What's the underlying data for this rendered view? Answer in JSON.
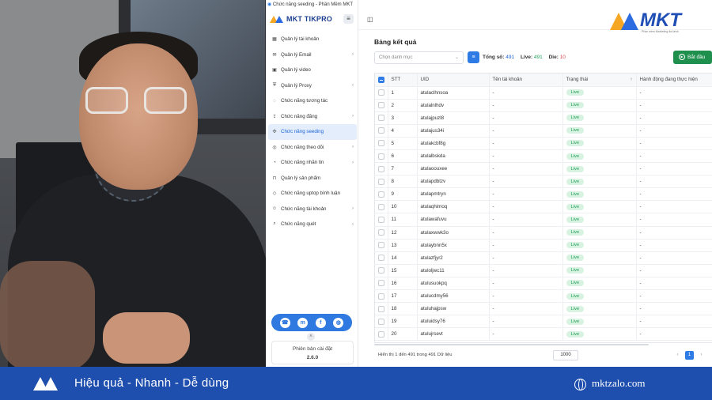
{
  "window": {
    "title": "Chức năng seeding - Phần Mềm MKT"
  },
  "sidebar": {
    "brand": "MKT TIKPRO",
    "items": [
      {
        "label": "Quản lý tài khoản",
        "icon": "grid-icon",
        "chevron": false,
        "active": false
      },
      {
        "label": "Quản lý Email",
        "icon": "mail-icon",
        "chevron": true,
        "active": false
      },
      {
        "label": "Quản lý video",
        "icon": "video-icon",
        "chevron": false,
        "active": false
      },
      {
        "label": "Quản lý Proxy",
        "icon": "shield-icon",
        "chevron": true,
        "active": false
      },
      {
        "label": "Chức năng tương tác",
        "icon": "chat-icon",
        "chevron": false,
        "active": false
      },
      {
        "label": "Chức năng đăng",
        "icon": "upload-icon",
        "chevron": true,
        "active": false
      },
      {
        "label": "Chức năng seeding",
        "icon": "seed-icon",
        "chevron": false,
        "active": true
      },
      {
        "label": "Chức năng theo dõi",
        "icon": "follow-icon",
        "chevron": true,
        "active": false
      },
      {
        "label": "Chức năng nhắn tin",
        "icon": "message-icon",
        "chevron": true,
        "active": false
      },
      {
        "label": "Quản lý sản phẩm",
        "icon": "cart-icon",
        "chevron": false,
        "active": false
      },
      {
        "label": "Chức năng uptop bình luận",
        "icon": "comment-icon",
        "chevron": false,
        "active": false
      },
      {
        "label": "Chức năng tài khoản",
        "icon": "user-icon",
        "chevron": true,
        "active": false
      },
      {
        "label": "Chức năng quét",
        "icon": "scan-icon",
        "chevron": true,
        "active": false
      }
    ],
    "version_label": "Phiên bản cài đặt",
    "version_value": "2.6.0"
  },
  "main": {
    "logo_text": "MKT",
    "card_title": "Bảng kết quả",
    "select_placeholder": "Chọn danh mục",
    "stats": {
      "total_label": "Tổng số:",
      "total": "491",
      "live_label": "Live:",
      "live": "491",
      "die_label": "Die:",
      "die": "10"
    },
    "start_button": "Bắt đầu",
    "columns": [
      "STT",
      "UID",
      "Tên tài khoản",
      "Trạng thái",
      "Hành động đang thực hiện"
    ],
    "rows": [
      {
        "stt": "1",
        "uid": "atulaclhnsoa",
        "name": "-",
        "status": "Live",
        "action": "-"
      },
      {
        "stt": "2",
        "uid": "atulalnlhdv",
        "name": "-",
        "status": "Live",
        "action": "-"
      },
      {
        "stt": "3",
        "uid": "atulajpuzl8",
        "name": "-",
        "status": "Live",
        "action": "-"
      },
      {
        "stt": "4",
        "uid": "atulajus34i",
        "name": "-",
        "status": "Live",
        "action": "-"
      },
      {
        "stt": "5",
        "uid": "atulakcbf8g",
        "name": "-",
        "status": "Live",
        "action": "-"
      },
      {
        "stt": "6",
        "uid": "atulalbskda",
        "name": "-",
        "status": "Live",
        "action": "-"
      },
      {
        "stt": "7",
        "uid": "atulaoouxee",
        "name": "-",
        "status": "Live",
        "action": "-"
      },
      {
        "stt": "8",
        "uid": "atulapdbtzv",
        "name": "-",
        "status": "Live",
        "action": "-"
      },
      {
        "stt": "9",
        "uid": "atulapmtryn",
        "name": "-",
        "status": "Live",
        "action": "-"
      },
      {
        "stt": "10",
        "uid": "atulaqhimoq",
        "name": "-",
        "status": "Live",
        "action": "-"
      },
      {
        "stt": "11",
        "uid": "atulawafuvu",
        "name": "-",
        "status": "Live",
        "action": "-"
      },
      {
        "stt": "12",
        "uid": "atulaxwwk3o",
        "name": "-",
        "status": "Live",
        "action": "-"
      },
      {
        "stt": "13",
        "uid": "atulaybnn5x",
        "name": "-",
        "status": "Live",
        "action": "-"
      },
      {
        "stt": "14",
        "uid": "atulazfjyr2",
        "name": "-",
        "status": "Live",
        "action": "-"
      },
      {
        "stt": "15",
        "uid": "atuloljwc11",
        "name": "-",
        "status": "Live",
        "action": "-"
      },
      {
        "stt": "16",
        "uid": "atulusuokpq",
        "name": "-",
        "status": "Live",
        "action": "-"
      },
      {
        "stt": "17",
        "uid": "atulucdmy56",
        "name": "-",
        "status": "Live",
        "action": "-"
      },
      {
        "stt": "18",
        "uid": "atuluhajpsw",
        "name": "-",
        "status": "Live",
        "action": "-"
      },
      {
        "stt": "19",
        "uid": "atuluidsy76",
        "name": "-",
        "status": "Live",
        "action": "-"
      },
      {
        "stt": "20",
        "uid": "atulujrsevt",
        "name": "-",
        "status": "Live",
        "action": "-"
      }
    ],
    "footer_text": "Hiển thị 1 đến 491 trong 491 Dữ liệu",
    "page_size": "1000",
    "current_page": "1"
  },
  "banner": {
    "logo_caption": "Phần mềm Marketing đa kênh",
    "tagline": "Hiệu quả - Nhanh - Dễ dùng",
    "website": "mktzalo.com"
  },
  "colors": {
    "primary": "#2f7be6",
    "brand": "#1f4fae",
    "live": "#1e9a54",
    "die": "#e04646",
    "start": "#1f8f4e",
    "logo_orange": "#f5a623"
  }
}
